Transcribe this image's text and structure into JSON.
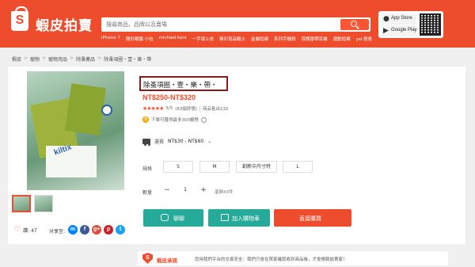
{
  "header": {
    "logo_letter": "S",
    "site_name": "蝦皮拍賣",
    "search_placeholder": "搜尋商品，品牌以及賣場",
    "hot_links": [
      "iPhone 7",
      "隱形眼鏡 小包",
      "michael kors",
      "一字領上衣",
      "無印良品戰士",
      "金屬短褲",
      "系列手機殼",
      "保護膠帶耳機",
      "運動短褲",
      "ysl 唇膏"
    ],
    "app_store_label": "App Store",
    "google_play_label": "Google Play"
  },
  "breadcrumb": [
    "蝦皮",
    "寵物",
    "寵物用品",
    "除蚤藥品",
    "除蚤項圈・壹・樂・帶"
  ],
  "product": {
    "title": "除蚤項圈・壹・樂・帶・",
    "price": "NT$250-NT$320",
    "stars": "★★★★★",
    "rating": "5/5",
    "review_count": "(63個評價)",
    "sold": "商品售出132",
    "coin_promo": "下單可獲得最多300蝦幣",
    "image_text": "kiltix",
    "shipping_label": "運費",
    "shipping_value": "NT$30 - NT$60",
    "spec_label": "規格",
    "variants": [
      "S",
      "M",
      "創新中尺寸特",
      "L"
    ],
    "quantity_label": "數量",
    "quantity_value": "1",
    "stock_text": "還剩43件",
    "chat_label": "聊聊",
    "add_to_cart_label": "加入購物車",
    "buy_now_label": "直接購買",
    "likes_label": "讚: 47",
    "share_label": "分享至:"
  },
  "guarantee": {
    "brand": "蝦皮承諾",
    "text": "您用我們平台的交易安全：我們只會在買家確認收到商品後，才會撥款給賣家！"
  },
  "colors": {
    "brand_orange": "#ee4d2d",
    "action_teal": "#26aa99",
    "title_box_border": "#8b1a1a"
  }
}
